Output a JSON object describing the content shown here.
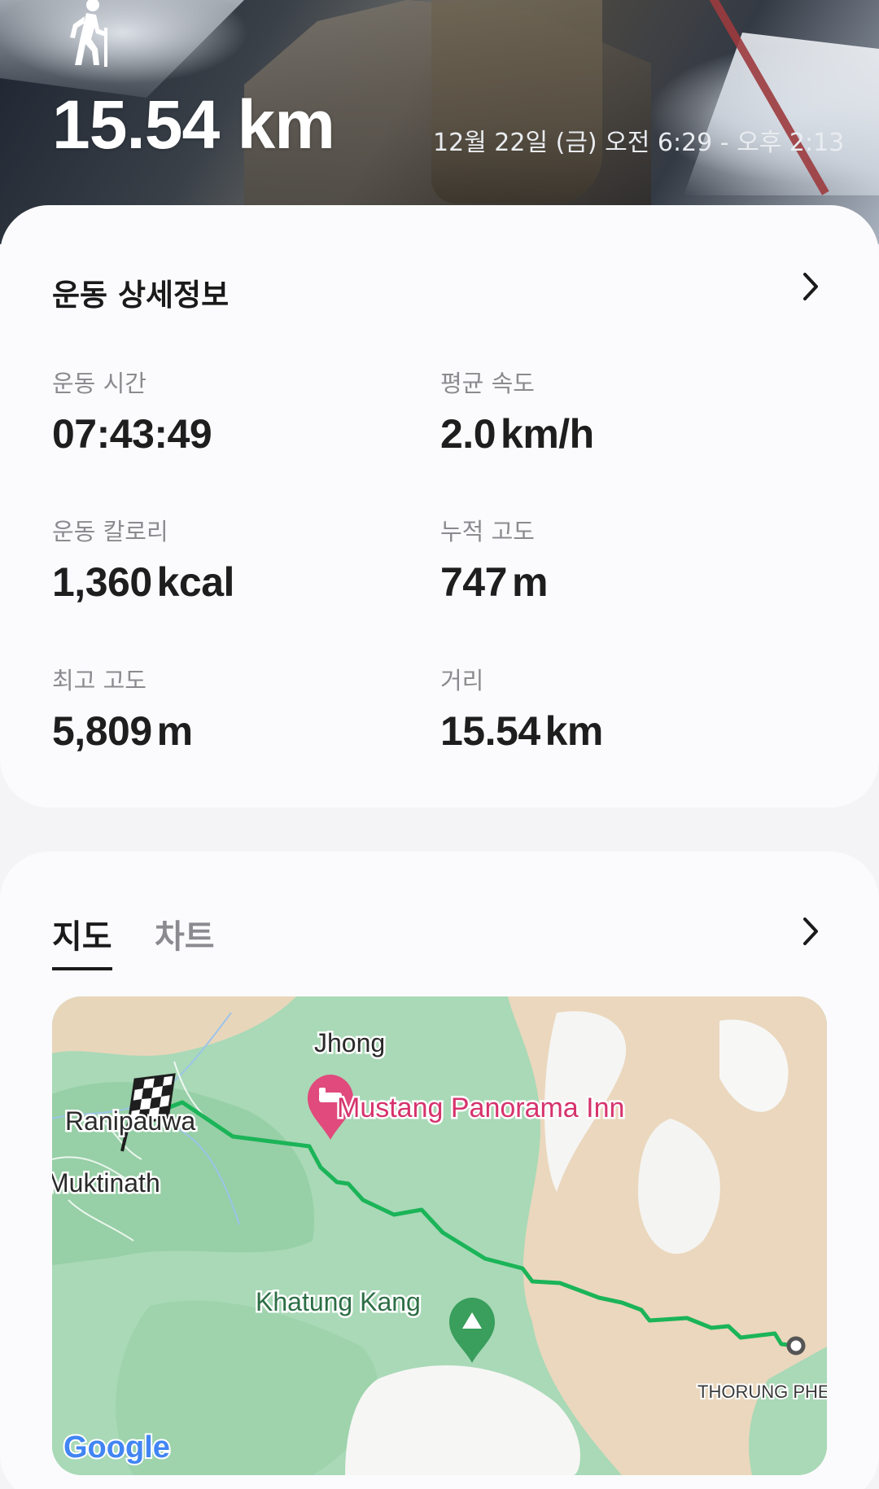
{
  "hero": {
    "activity_icon": "hiking-person-icon",
    "distance": "15.54 km",
    "date_range": "12월 22일 (금) 오전 6:29 - 오후 2:13"
  },
  "details": {
    "title": "운동 상세정보",
    "stats": [
      {
        "label": "운동 시간",
        "value": "07:43:49",
        "unit": ""
      },
      {
        "label": "평균 속도",
        "value": "2.0",
        "unit": "km/h"
      },
      {
        "label": "운동 칼로리",
        "value": "1,360",
        "unit": "kcal"
      },
      {
        "label": "누적 고도",
        "value": "747",
        "unit": "m"
      },
      {
        "label": "최고 고도",
        "value": "5,809",
        "unit": "m"
      },
      {
        "label": "거리",
        "value": "15.54",
        "unit": "km"
      }
    ]
  },
  "map_section": {
    "tabs": [
      "지도",
      "차트"
    ],
    "active_tab": "지도",
    "places": {
      "jhong": "Jhong",
      "inn": "Mustang Panorama Inn",
      "ranipauwa": "Ranipauwa",
      "muktinath": "Muktinath",
      "khatung": "Khatung Kang",
      "thorung": "THORUNG PHEI"
    },
    "logo": "Google",
    "colors": {
      "route": "#1bb458",
      "poi_pink": "#e04a7c",
      "peak_green": "#3a9e5c",
      "map_green": "#a9d9b7",
      "map_tan": "#ead7bd"
    }
  }
}
